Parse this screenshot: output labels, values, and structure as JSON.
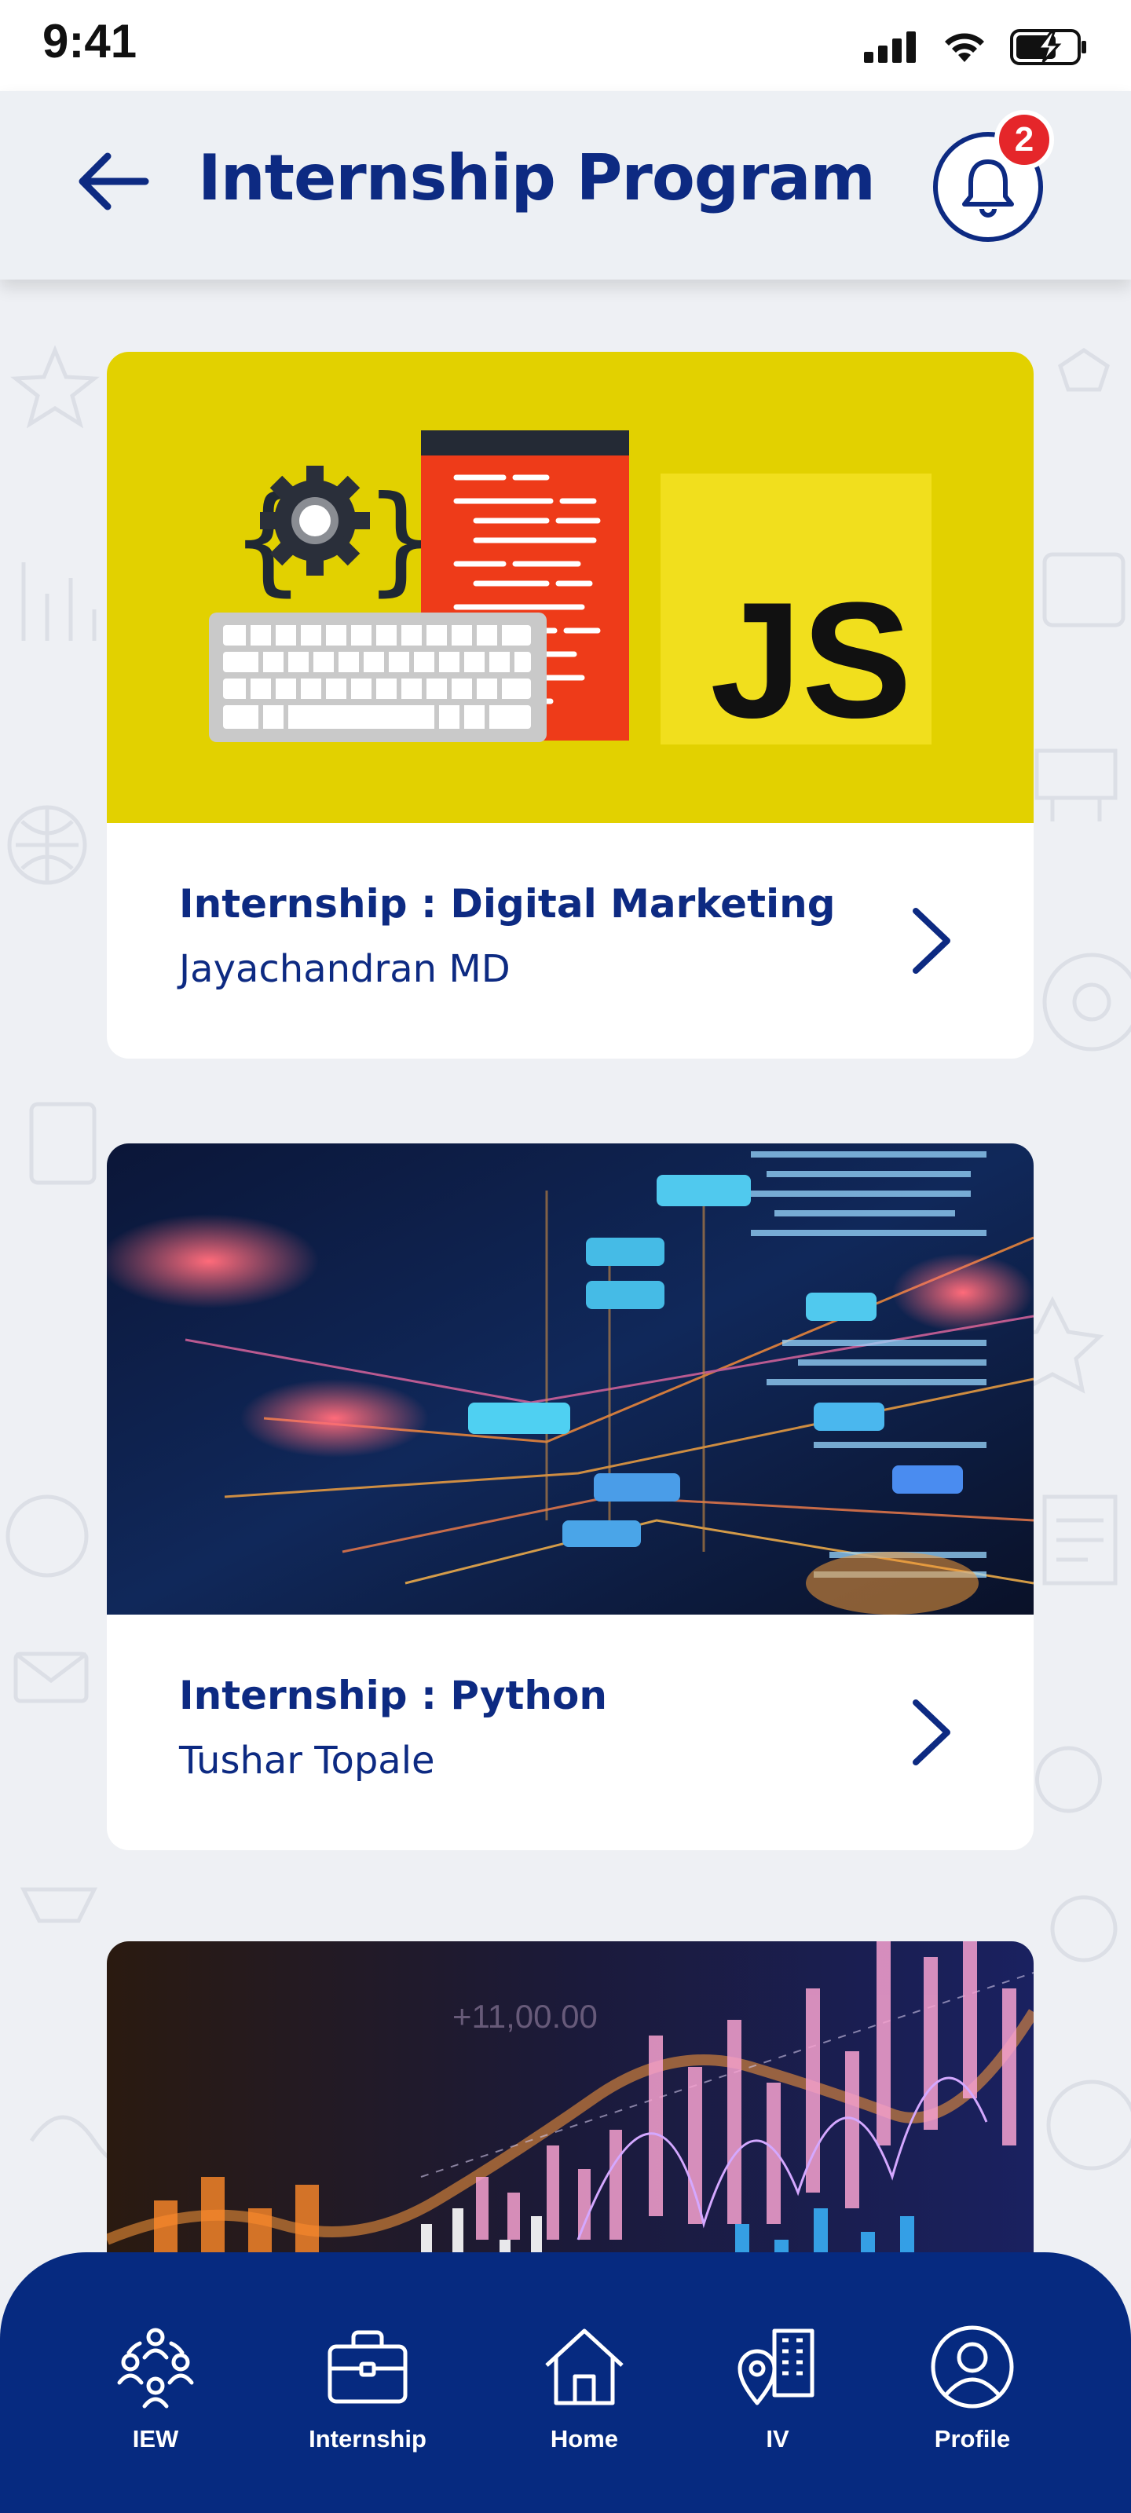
{
  "status_bar": {
    "time": "9:41"
  },
  "header": {
    "title": "Internship Program",
    "notification_count": "2"
  },
  "cards": [
    {
      "title": "Internship : Digital Marketing",
      "author": "Jayachandran MD",
      "image_text": "JS"
    },
    {
      "title": "Internship : Python",
      "author": "Tushar Topale"
    },
    {
      "title": "",
      "author": "",
      "image_text": "+11,00.00"
    }
  ],
  "bottom_nav": {
    "items": [
      {
        "label": "IEW",
        "icon": "team-icon"
      },
      {
        "label": "Internship",
        "icon": "briefcase-icon"
      },
      {
        "label": "Home",
        "icon": "home-icon"
      },
      {
        "label": "IV",
        "icon": "location-building-icon"
      },
      {
        "label": "Profile",
        "icon": "profile-icon"
      }
    ]
  },
  "colors": {
    "primary": "#0d2a82",
    "nav_background": "#062a80",
    "badge": "#e5262a",
    "page_background": "#eef0f4"
  }
}
